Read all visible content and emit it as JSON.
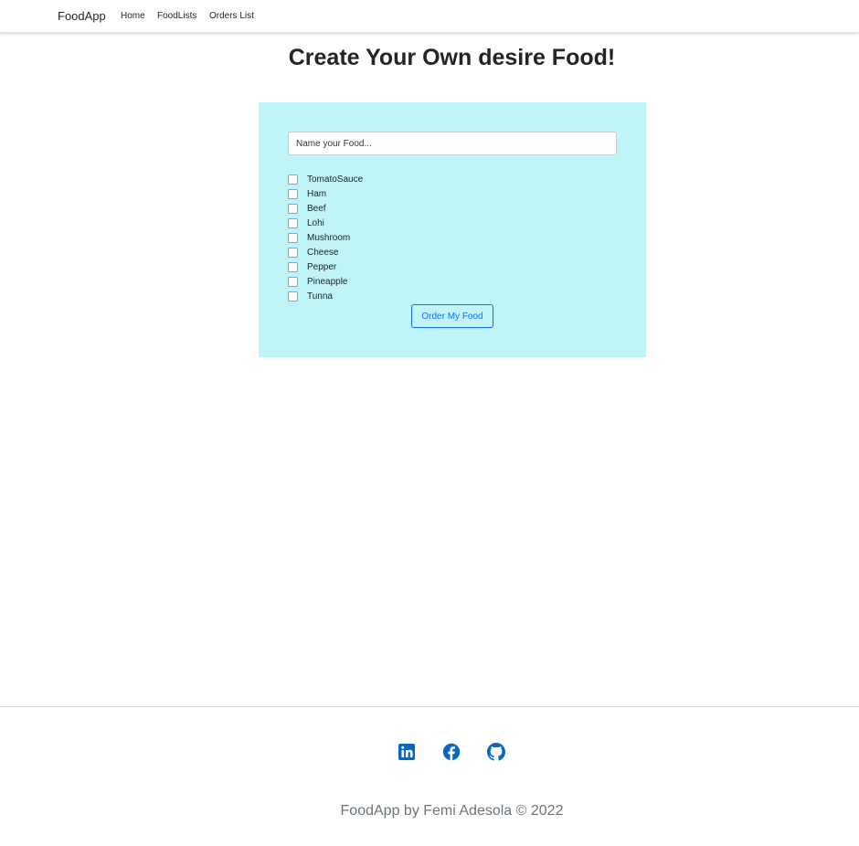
{
  "navbar": {
    "brand": "FoodApp",
    "links": [
      {
        "label": "Home"
      },
      {
        "label": "FoodLists"
      },
      {
        "label": "Orders List"
      }
    ]
  },
  "page": {
    "title": "Create Your Own desire Food!"
  },
  "form": {
    "name_input": {
      "value": "",
      "placeholder": "Name your Food..."
    },
    "ingredients": [
      {
        "label": "TomatoSauce",
        "checked": false
      },
      {
        "label": "Ham",
        "checked": false
      },
      {
        "label": "Beef",
        "checked": false
      },
      {
        "label": "Lohi",
        "checked": false
      },
      {
        "label": "Mushroom",
        "checked": false
      },
      {
        "label": "Cheese",
        "checked": false
      },
      {
        "label": "Pepper",
        "checked": false
      },
      {
        "label": "Pineapple",
        "checked": false
      },
      {
        "label": "Tunna",
        "checked": false
      }
    ],
    "submit_label": "Order My Food"
  },
  "footer": {
    "social_icons": [
      "linkedin-icon",
      "facebook-icon",
      "github-icon"
    ],
    "copyright": "FoodApp by Femi Adesola © 2022"
  },
  "colors": {
    "card_background": "#c0f4f8",
    "primary": "#0d6efd",
    "muted_text": "#6c757d",
    "icon_blue": "#0a66c2"
  }
}
